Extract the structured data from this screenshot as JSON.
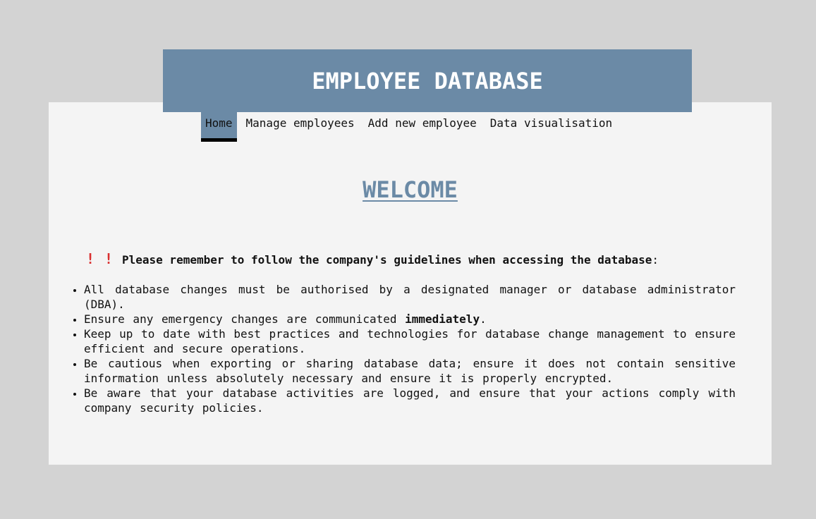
{
  "header": {
    "title": "EMPLOYEE DATABASE"
  },
  "nav": {
    "items": [
      {
        "label": "Home",
        "active": true
      },
      {
        "label": "Manage employees",
        "active": false
      },
      {
        "label": "Add new employee",
        "active": false
      },
      {
        "label": "Data visualisation",
        "active": false
      }
    ]
  },
  "main": {
    "heading": "WELCOME",
    "notice": {
      "icons": [
        "exclamation-icon",
        "exclamation-icon"
      ],
      "text": "Please remember to follow the company's guidelines when accessing the database",
      "suffix": ":"
    },
    "guidelines": [
      {
        "text": "All database changes must be authorised by a designated manager or database administrator (DBA)."
      },
      {
        "text_before": "Ensure any emergency changes are communicated ",
        "bold": "immediately",
        "text_after": "."
      },
      {
        "text": "Keep up to date with best practices and technologies for database change management to ensure efficient and secure operations."
      },
      {
        "text": "Be cautious when exporting or sharing database data; ensure it does not contain sensitive information unless absolutely necessary and ensure it is properly encrypted."
      },
      {
        "text": "Be aware that your database activities are logged, and ensure that your actions comply with company security policies."
      }
    ]
  },
  "colors": {
    "accent": "#6b8aa6",
    "page_background": "#d3d3d3",
    "panel_background": "#f4f4f4",
    "alert": "#d93030"
  }
}
